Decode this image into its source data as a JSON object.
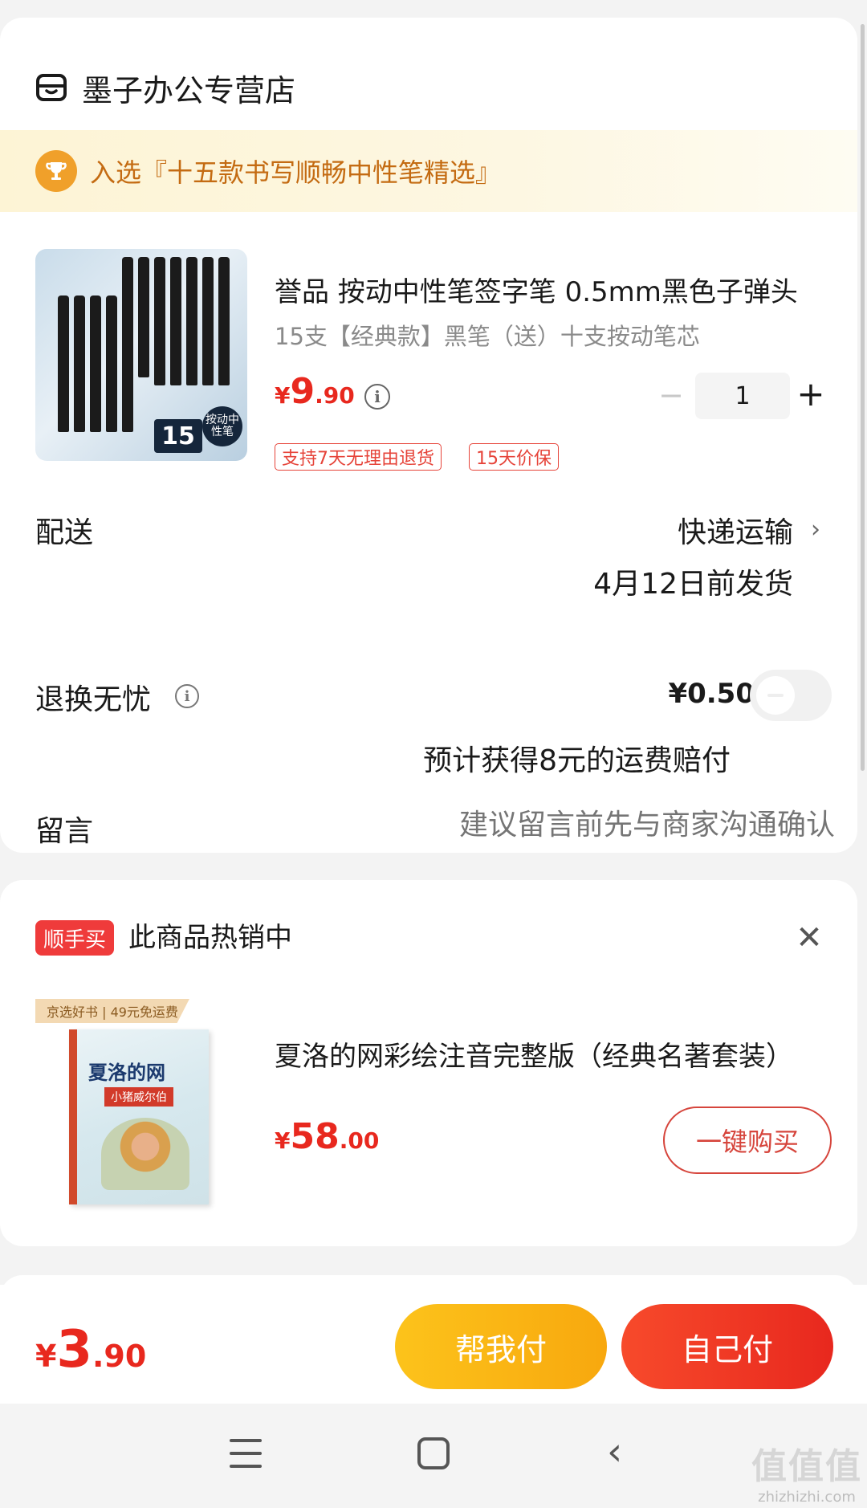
{
  "store": {
    "name": "墨子办公专营店",
    "banner": "入选『十五款书写顺畅中性笔精选』"
  },
  "product": {
    "title": "誉品 按动中性笔签字笔 0.5mm黑色子弹头",
    "spec": "15支【经典款】黑笔（送）十支按动笔芯",
    "price": {
      "symbol": "¥",
      "int": "9",
      "dec": ".90"
    },
    "quantity": "1",
    "tags": [
      "支持7天无理由退货",
      "15天价保"
    ],
    "image_badge": "15",
    "image_badge2": "按动中性笔"
  },
  "delivery": {
    "label": "配送",
    "method": "快递运输",
    "date": "4月12日前发货"
  },
  "returns": {
    "label": "退换无忧",
    "price": "¥0.50",
    "note": "预计获得8元的运费赔付",
    "enabled": false
  },
  "message": {
    "label": "留言",
    "placeholder": "建议留言前先与商家沟通确认"
  },
  "recommendation": {
    "badge": "顺手买",
    "title": "此商品热销中",
    "item_name": "夏洛的网彩绘注音完整版（经典名著套装）",
    "book_label": "京选好书 | 49元免运费",
    "book_title": "夏洛的网",
    "book_subtitle": "小猪威尔伯",
    "price": {
      "symbol": "¥",
      "int": "58",
      "dec": ".00"
    },
    "buy_label": "一键购买"
  },
  "checkout": {
    "total": {
      "symbol": "¥",
      "int": "3",
      "dec": ".90"
    },
    "help_pay": "帮我付",
    "self_pay": "自己付"
  },
  "watermark": {
    "big": "值值值",
    "small": "zhizhizhi.com"
  },
  "colors": {
    "accent_red": "#e8281e",
    "banner_text": "#c46b12",
    "help_pay_yellow": "#fcc31b"
  }
}
